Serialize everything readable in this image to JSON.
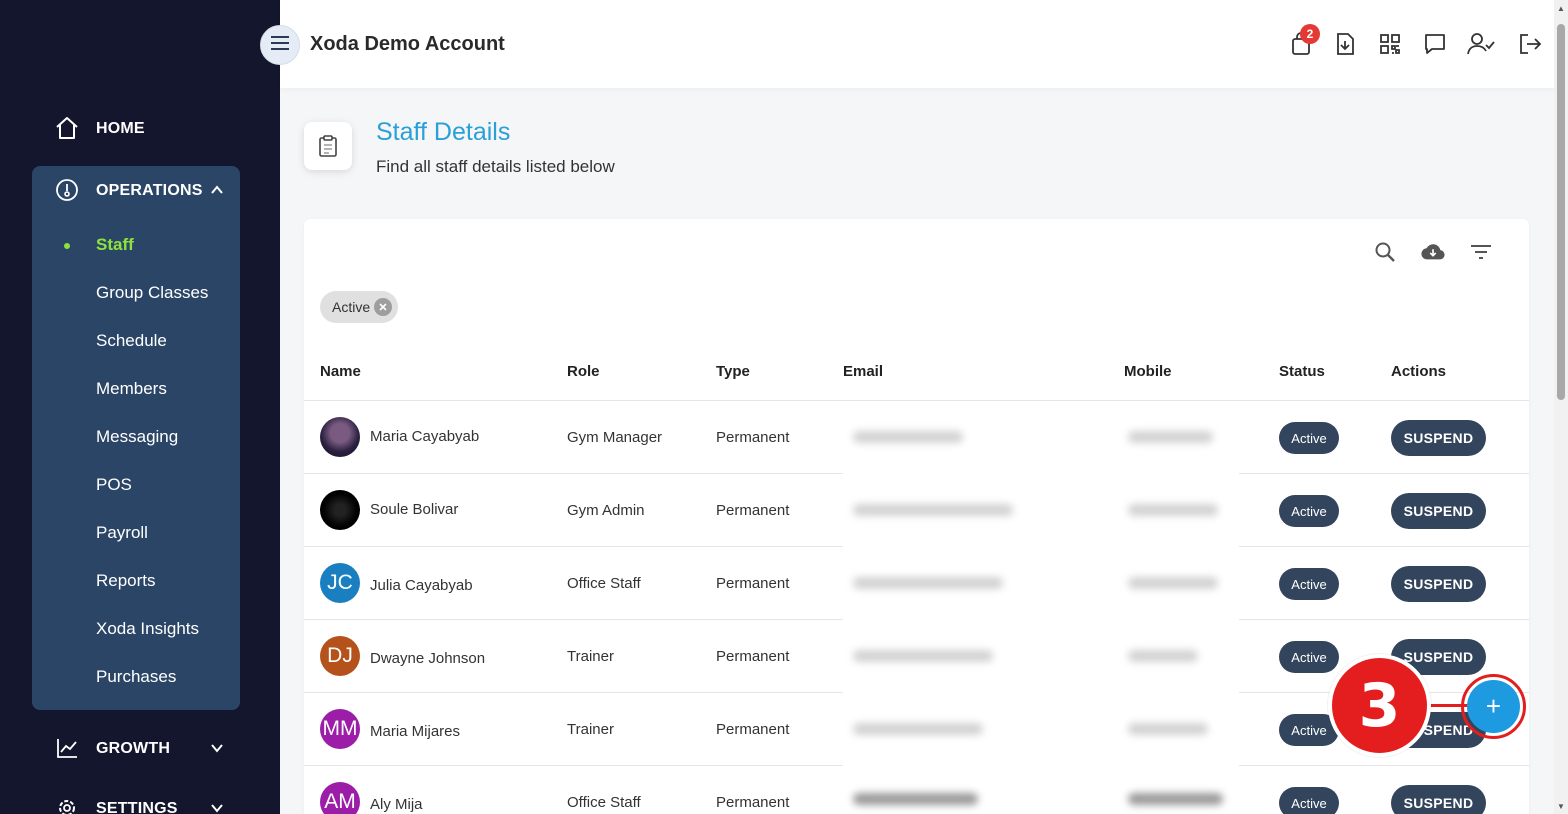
{
  "sidebar": {
    "home_label": "HOME",
    "operations_label": "OPERATIONS",
    "growth_label": "GROWTH",
    "settings_label": "SETTINGS",
    "sub_items": [
      "Staff",
      "Group Classes",
      "Schedule",
      "Members",
      "Messaging",
      "POS",
      "Payroll",
      "Reports",
      "Xoda Insights",
      "Purchases"
    ],
    "active_item": "Staff"
  },
  "header": {
    "account_name": "Xoda Demo Account",
    "cart_badge": "2"
  },
  "page": {
    "title": "Staff Details",
    "subtitle": "Find all staff details listed below"
  },
  "filter": {
    "chip_label": "Active"
  },
  "table": {
    "columns": [
      "Name",
      "Role",
      "Type",
      "Email",
      "Mobile",
      "Status",
      "Actions"
    ],
    "rows": [
      {
        "name": "Maria Cayabyab",
        "initials": "",
        "role": "Gym Manager",
        "type": "Permanent",
        "status": "Active",
        "action": "SUSPEND"
      },
      {
        "name": "Soule Bolivar",
        "initials": "",
        "role": "Gym Admin",
        "type": "Permanent",
        "status": "Active",
        "action": "SUSPEND"
      },
      {
        "name": "Julia Cayabyab",
        "initials": "JC",
        "role": "Office Staff",
        "type": "Permanent",
        "status": "Active",
        "action": "SUSPEND"
      },
      {
        "name": "Dwayne Johnson",
        "initials": "DJ",
        "role": "Trainer",
        "type": "Permanent",
        "status": "Active",
        "action": "SUSPEND"
      },
      {
        "name": "Maria Mijares",
        "initials": "MM",
        "role": "Trainer",
        "type": "Permanent",
        "status": "Active",
        "action": "SUSPEND"
      },
      {
        "name": "Aly Mija",
        "initials": "AM",
        "role": "Office Staff",
        "type": "Permanent",
        "status": "Active",
        "action": "SUSPEND"
      }
    ]
  },
  "fab": {
    "label": "+"
  },
  "step_marker": {
    "label": "3"
  },
  "colors": {
    "sidebar_bg": "#13162d",
    "panel_bg": "#2b4566",
    "active_green": "#8ee23d",
    "title_blue": "#2a9fd8",
    "pill_bg": "#33455d",
    "fab_blue": "#1e9be0",
    "marker_red": "#e41e1e"
  }
}
